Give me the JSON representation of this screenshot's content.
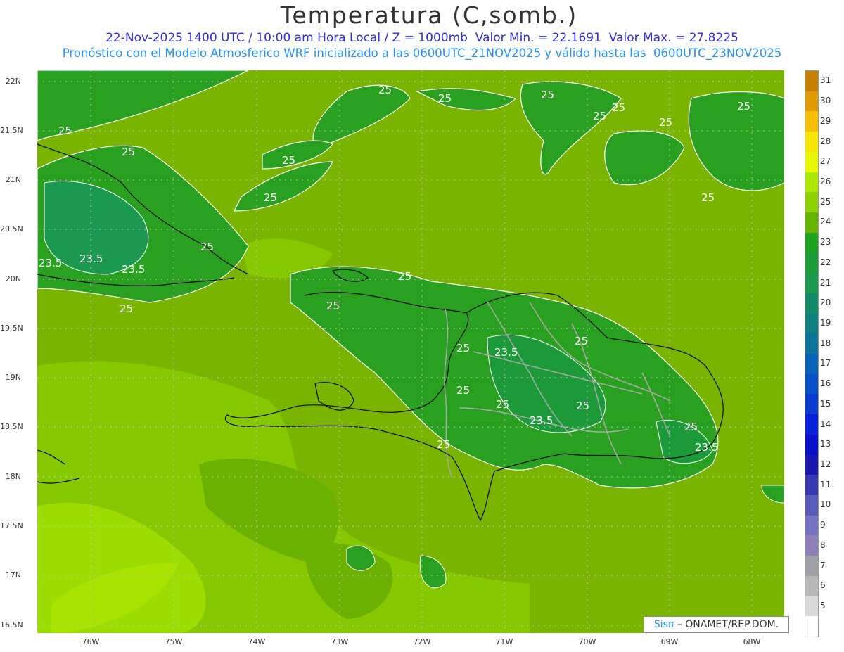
{
  "title": "Temperatura (C,somb.)",
  "subtitle_1": "22-Nov-2025 1400 UTC / 10:00 am Hora Local / Z = 1000mb  Valor Min. = 22.1691  Valor Max. = 27.8225",
  "subtitle_2": "Pronóstico con el Modelo Atmosferico WRF inicializado a las 0600UTC_21NOV2025 y válido hasta las  0600UTC_23NOV2025",
  "lat_labels": [
    "22N",
    "21.5N",
    "21N",
    "20.5N",
    "20N",
    "19.5N",
    "19N",
    "18.5N",
    "18N",
    "17.5N",
    "17N",
    "16.5N"
  ],
  "lon_labels": [
    "76W",
    "75W",
    "74W",
    "73W",
    "72W",
    "71W",
    "70W",
    "69W",
    "68W"
  ],
  "contour_labels": [
    "25",
    "25",
    "25",
    "25",
    "25",
    "25",
    "25",
    "25",
    "25",
    "25",
    "25",
    "25",
    "25",
    "25",
    "25",
    "25",
    "25",
    "25",
    "25",
    "25",
    "25",
    "25",
    "25",
    "23.5",
    "23.5",
    "23.5",
    "23.5",
    "23.5",
    "23.5"
  ],
  "colorbar": [
    {
      "label": "31",
      "color": "#c68000"
    },
    {
      "label": "30",
      "color": "#e09a00"
    },
    {
      "label": "29",
      "color": "#f5be00"
    },
    {
      "label": "28",
      "color": "#f7e600"
    },
    {
      "label": "27",
      "color": "#e6f700"
    },
    {
      "label": "26",
      "color": "#aee600"
    },
    {
      "label": "25",
      "color": "#8cd200"
    },
    {
      "label": "24",
      "color": "#64b400"
    },
    {
      "label": "23",
      "color": "#1fa01f"
    },
    {
      "label": "22",
      "color": "#1d9b3a"
    },
    {
      "label": "21",
      "color": "#1c9950"
    },
    {
      "label": "20",
      "color": "#138a6a"
    },
    {
      "label": "19",
      "color": "#0f8080"
    },
    {
      "label": "18",
      "color": "#0d7399"
    },
    {
      "label": "17",
      "color": "#0a62b8"
    },
    {
      "label": "16",
      "color": "#0850c8"
    },
    {
      "label": "15",
      "color": "#0a3ad2"
    },
    {
      "label": "14",
      "color": "#0820d8"
    },
    {
      "label": "13",
      "color": "#0a10c8"
    },
    {
      "label": "12",
      "color": "#1818b0"
    },
    {
      "label": "11",
      "color": "#3838b0"
    },
    {
      "label": "10",
      "color": "#5a5ab8"
    },
    {
      "label": "9",
      "color": "#7474c0"
    },
    {
      "label": "8",
      "color": "#9080b8"
    },
    {
      "label": "7",
      "color": "#a0a0a8"
    },
    {
      "label": "6",
      "color": "#b8b8b8"
    },
    {
      "label": "5",
      "color": "#d8d8d8"
    },
    {
      "label": "",
      "color": "#ffffff"
    }
  ],
  "credit_brand": "Sisπ",
  "credit_text": "– ONAMET/REP.DOM.",
  "colors": {
    "sea": "#78b400",
    "land_warm": "#8cd200",
    "cool": "#1fa01f",
    "mid": "#64b400"
  }
}
